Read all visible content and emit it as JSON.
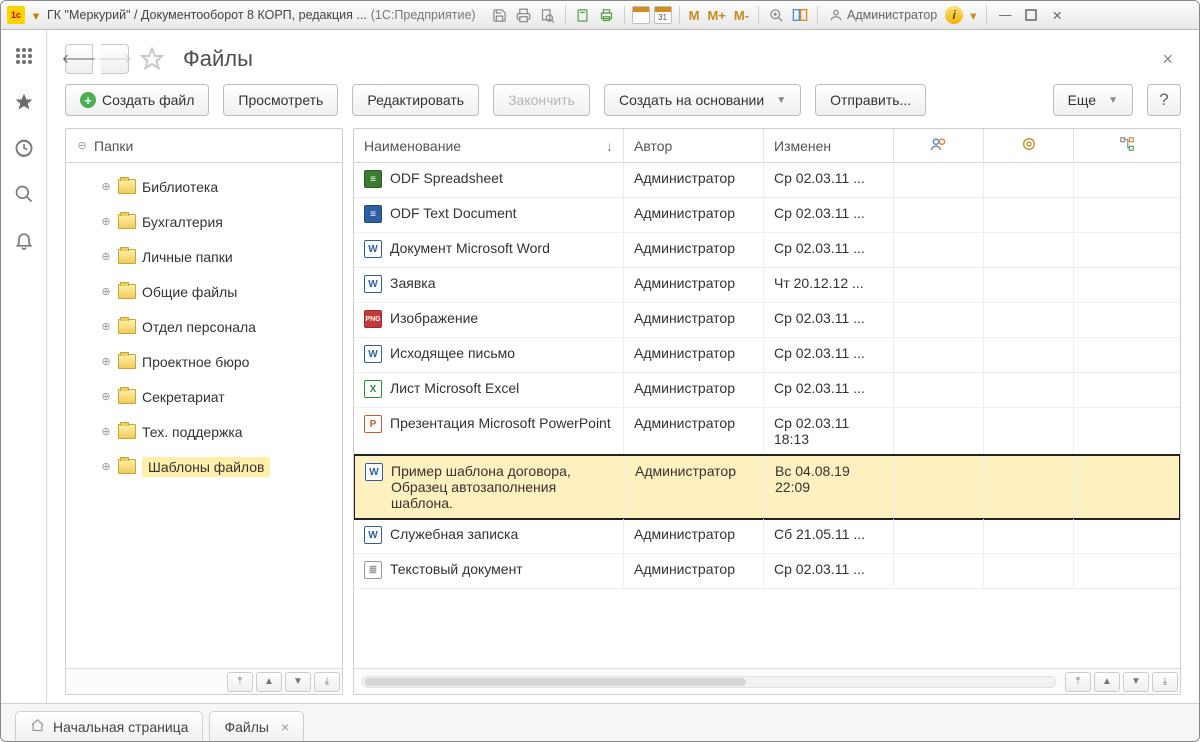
{
  "titlebar": {
    "title": "ГК \"Меркурий\" / Документооборот 8 КОРП, редакция ...",
    "platform": "(1С:Предприятие)",
    "cal1": "",
    "cal2": "31",
    "m": "M",
    "mp": "M+",
    "mm": "M-",
    "user": "Администратор"
  },
  "page": {
    "title": "Файлы"
  },
  "toolbar": {
    "create": "Создать файл",
    "view": "Просмотреть",
    "edit": "Редактировать",
    "finish": "Закончить",
    "createFrom": "Создать на основании",
    "send": "Отправить...",
    "more": "Еще",
    "help": "?"
  },
  "tree": {
    "header": "Папки",
    "items": [
      {
        "label": "Библиотека"
      },
      {
        "label": "Бухгалтерия"
      },
      {
        "label": "Личные папки"
      },
      {
        "label": "Общие файлы"
      },
      {
        "label": "Отдел персонала"
      },
      {
        "label": "Проектное бюро"
      },
      {
        "label": "Секретариат"
      },
      {
        "label": "Тех. поддержка"
      },
      {
        "label": "Шаблоны файлов",
        "selected": true
      }
    ]
  },
  "list": {
    "columns": {
      "name": "Наименование",
      "author": "Автор",
      "changed": "Изменен"
    },
    "rows": [
      {
        "icon": "odf-s",
        "name": "ODF Spreadsheet",
        "author": "Администратор",
        "changed": "Ср 02.03.11 ..."
      },
      {
        "icon": "odf-t",
        "name": "ODF Text Document",
        "author": "Администратор",
        "changed": "Ср 02.03.11 ..."
      },
      {
        "icon": "word",
        "name": "Документ Microsoft Word",
        "author": "Администратор",
        "changed": "Ср 02.03.11 ..."
      },
      {
        "icon": "word",
        "name": "Заявка",
        "author": "Администратор",
        "changed": "Чт 20.12.12 ..."
      },
      {
        "icon": "png",
        "name": "Изображение",
        "author": "Администратор",
        "changed": "Ср 02.03.11 ..."
      },
      {
        "icon": "word",
        "name": "Исходящее письмо",
        "author": "Администратор",
        "changed": "Ср 02.03.11 ..."
      },
      {
        "icon": "excel",
        "name": "Лист Microsoft Excel",
        "author": "Администратор",
        "changed": "Ср 02.03.11 ..."
      },
      {
        "icon": "ppt",
        "name": "Презентация Microsoft PowerPoint",
        "author": "Администратор",
        "changed": "Ср 02.03.11 18:13"
      },
      {
        "icon": "word",
        "name": "Пример шаблона договора, Образец автозаполнения шаблона.",
        "author": "Администратор",
        "changed": "Вс 04.08.19 22:09",
        "selected": true
      },
      {
        "icon": "word",
        "name": "Служебная записка",
        "author": "Администратор",
        "changed": "Сб 21.05.11 ..."
      },
      {
        "icon": "txt",
        "name": "Текстовый документ",
        "author": "Администратор",
        "changed": "Ср 02.03.11 ..."
      }
    ]
  },
  "tabs": {
    "home": "Начальная страница",
    "files": "Файлы"
  }
}
